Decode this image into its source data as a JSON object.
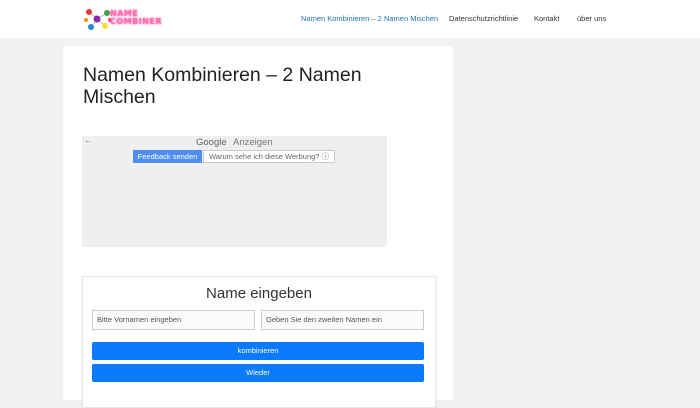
{
  "header": {
    "logo_text_line1": "NAME",
    "logo_text_line2": "COMBINER",
    "nav": [
      {
        "label": "Namen Kombinieren – 2 Namen Mischen",
        "active": true
      },
      {
        "label": "Datenschutzrichtlinie"
      },
      {
        "label": "Kontakt"
      },
      {
        "label": "über uns"
      }
    ]
  },
  "page": {
    "title": "Namen Kombinieren – 2 Namen Mischen"
  },
  "ad": {
    "back_icon": "←",
    "google": "Google",
    "anzeigen": "Anzeigen",
    "feedback": "Feedback senden",
    "why": "Warum sehe ich diese Werbung? ⓘ"
  },
  "form": {
    "title": "Name eingeben",
    "first_placeholder": "Bitte Vornamen eingeben",
    "second_placeholder": "Geben Sie den zweiten Namen ein",
    "combine_label": "kombinieren",
    "again_label": "Wieder"
  },
  "colors": {
    "accent": "#0b7aff",
    "nav_active": "#1e73be"
  }
}
